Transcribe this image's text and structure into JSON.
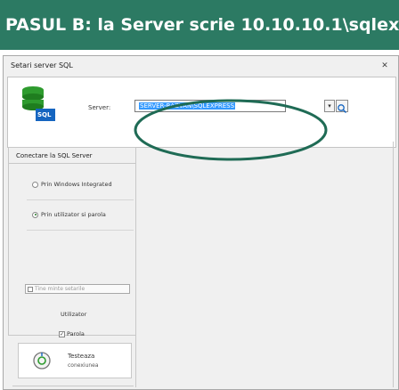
{
  "banner": {
    "text": "PASUL B: la Server scrie 10.10.10.1\\sqlexpress"
  },
  "dialog": {
    "title": "Setari server SQL",
    "close": "✕",
    "db_icon_label": "SQL",
    "server_label": "Server:",
    "server_value": "SERVER-RAZVAN\\SQLEXPRESS",
    "section_connect": "Conectare la SQL Server",
    "radio_windows": "Prin Windows Integrated",
    "radio_user": "Prin utilizator si parola",
    "user_label": "Utilizator",
    "password_check": "✓",
    "password_label": "Parola",
    "remember_label": "Tine minte setarile",
    "test_label": "Testeaza",
    "test_sub": "conexiunea",
    "dropdown_glyph": "▾"
  },
  "colors": {
    "banner_bg": "#2c7a63",
    "highlight": "#1f6b55",
    "selection": "#3399ff"
  }
}
